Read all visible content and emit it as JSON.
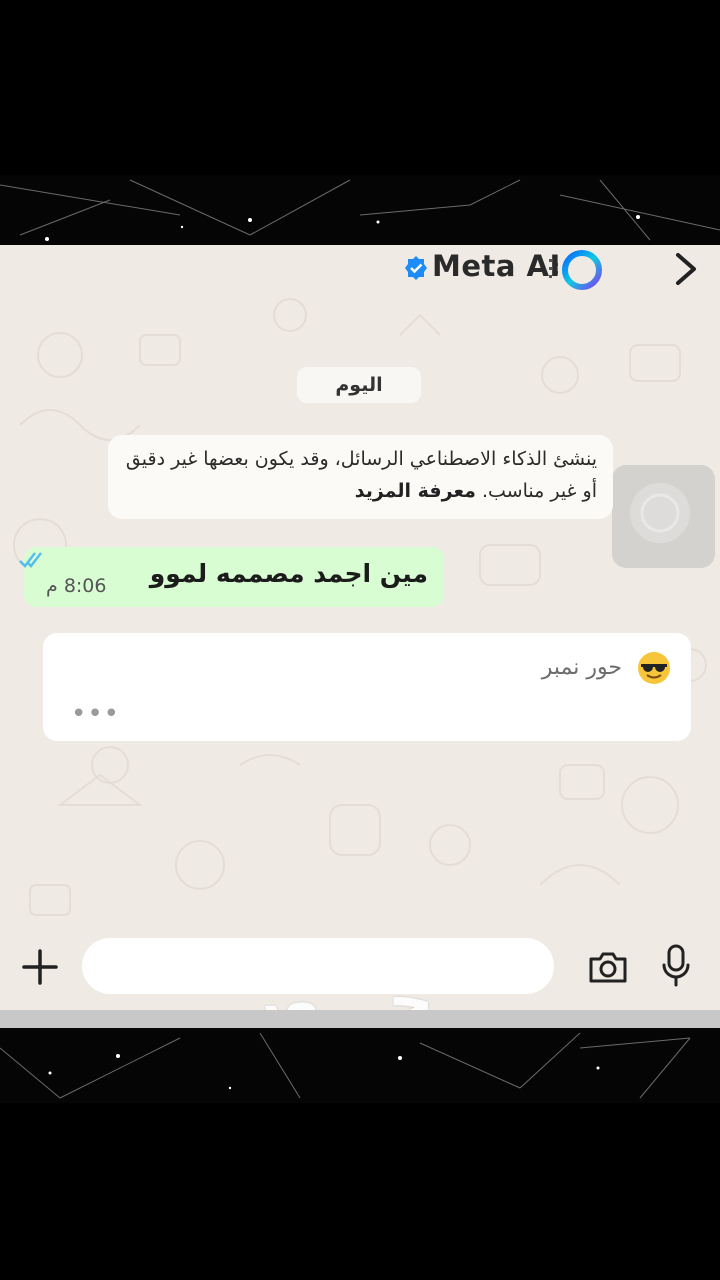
{
  "header": {
    "title": "Meta AI",
    "back_icon": "chevron-right-icon",
    "verified_icon": "verified-badge-icon",
    "ring_icon": "meta-ai-ring-icon",
    "ring_colors": [
      "#0866ff",
      "#0fc9e3",
      "#7b3ef0"
    ]
  },
  "chat": {
    "date_label": "اليوم",
    "system_notice": {
      "text": "ينشئ الذكاء الاصطناعي الرسائل، وقد يكون بعضها غير دقيق أو غير مناسب.",
      "link": "معرفة المزيد"
    },
    "outgoing": {
      "text": "مين اجمد مصممه لموو",
      "time": "8:06 م",
      "status_icon": "double-check-icon",
      "bubble_color": "#d9fdd3"
    },
    "incoming": {
      "text": "حور نمبر",
      "emoji_icon": "sunglasses-face-icon",
      "typing": "•••"
    }
  },
  "composer": {
    "plus_icon": "plus-icon",
    "input_value": "",
    "camera_icon": "camera-icon",
    "mic_icon": "microphone-icon"
  },
  "overlay": {
    "watermark": "حـــور"
  },
  "colors": {
    "chat_background": "#efeae4",
    "accent_blue": "#53bdeb"
  }
}
